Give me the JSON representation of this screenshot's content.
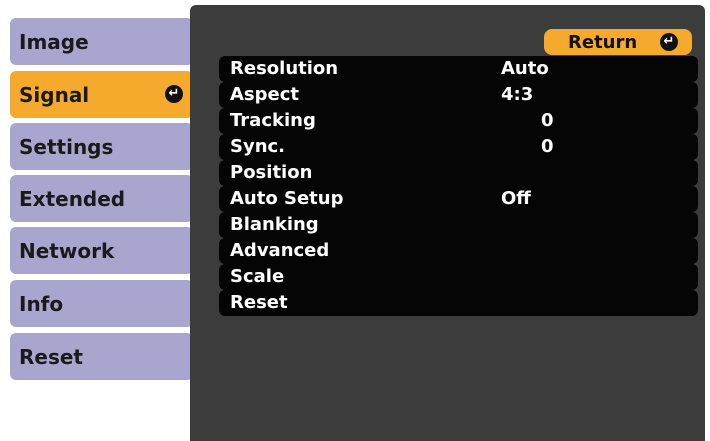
{
  "sidebar": {
    "tabs": [
      {
        "label": "Image",
        "active": false
      },
      {
        "label": "Signal",
        "active": true,
        "enter_icon": "enter-icon"
      },
      {
        "label": "Settings",
        "active": false
      },
      {
        "label": "Extended",
        "active": false
      },
      {
        "label": "Network",
        "active": false
      },
      {
        "label": "Info",
        "active": false
      },
      {
        "label": "Reset",
        "active": false
      }
    ]
  },
  "header": {
    "return_label": "Return",
    "return_icon": "enter-icon"
  },
  "menu": {
    "items": [
      {
        "label": "Resolution",
        "value": "Auto"
      },
      {
        "label": "Aspect",
        "value": "4:3"
      },
      {
        "label": "Tracking",
        "value": "0"
      },
      {
        "label": "Sync.",
        "value": "0"
      },
      {
        "label": "Position",
        "value": ""
      },
      {
        "label": "Auto Setup",
        "value": "Off"
      },
      {
        "label": "Blanking",
        "value": ""
      },
      {
        "label": "Advanced",
        "value": ""
      },
      {
        "label": "Scale",
        "value": ""
      },
      {
        "label": "Reset",
        "value": ""
      }
    ]
  },
  "colors": {
    "tab_inactive": "#a8a6cf",
    "tab_active": "#f5aa2d",
    "panel_bg": "#3c3c3c",
    "row_bg": "#050505",
    "row_text": "#ffffff"
  }
}
